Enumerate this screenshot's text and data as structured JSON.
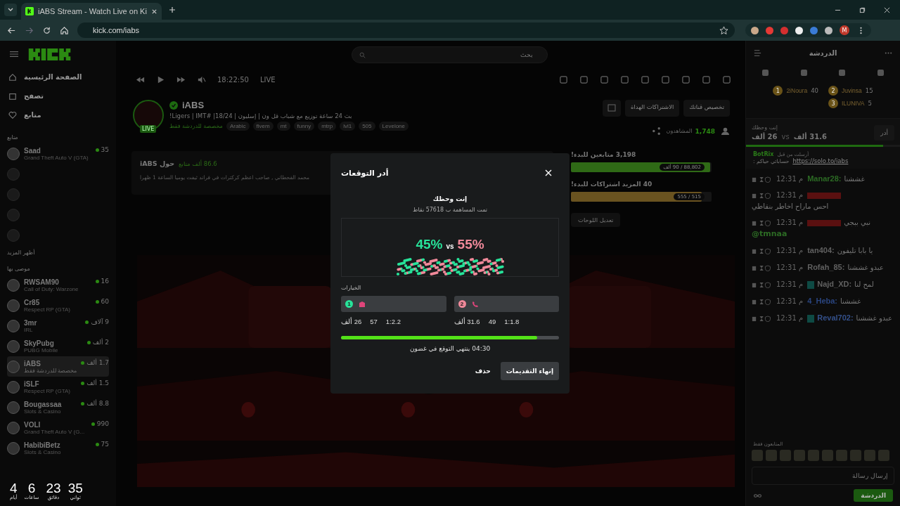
{
  "browser": {
    "tab_title": "iABS Stream - Watch Live on Ki",
    "url": "kick.com/iabs",
    "profile_letter": "M"
  },
  "search": {
    "placeholder": "بحث"
  },
  "sidebar": {
    "nav": [
      {
        "label": "الصفحة الرئيسية"
      },
      {
        "label": "تصفح"
      },
      {
        "label": "متابع"
      }
    ],
    "following_heading": "متابع",
    "following": [
      {
        "name": "Saad",
        "category": "Grand Theft Auto V (GTA)",
        "viewers": "35",
        "live": true
      },
      {
        "live": false
      },
      {
        "live": false
      },
      {
        "live": false
      },
      {
        "live": false
      }
    ],
    "show_more": "أظهر المزيد",
    "recommended_heading": "موصى بها",
    "recommended": [
      {
        "name": "RWSAM90",
        "category": "Call of Duty: Warzone",
        "viewers": "16",
        "selected": false
      },
      {
        "name": "Cr85",
        "category": "Respect RP (GTA)",
        "viewers": "60",
        "selected": false
      },
      {
        "name": "3mr",
        "category": "IRL",
        "viewers": "9 آلاف",
        "selected": false
      },
      {
        "name": "SkyPubg",
        "category": "PUBG Mobile",
        "viewers": "2 ألف",
        "selected": false
      },
      {
        "name": "iABS",
        "category": "مخصصة للدردشة فقط",
        "viewers": "1.7 ألف",
        "selected": true
      },
      {
        "name": "iSLF",
        "category": "Respect RP (GTA)",
        "viewers": "1.5 ألف",
        "selected": false
      },
      {
        "name": "Bougassaa",
        "category": "Slots & Casino",
        "viewers": "8.8 ألف",
        "selected": false
      },
      {
        "name": "VOLI",
        "category": "Grand Theft Auto V (G...",
        "viewers": "990",
        "selected": false
      },
      {
        "name": "HabibiBetz",
        "category": "Slots & Casino",
        "viewers": "75",
        "selected": false
      }
    ]
  },
  "countdown": [
    {
      "value": "35",
      "unit": "ثواني"
    },
    {
      "value": "23",
      "unit": "دقائق"
    },
    {
      "value": "6",
      "unit": "ساعات"
    },
    {
      "value": "4",
      "unit": "أيام"
    }
  ],
  "player": {
    "time": "18:22:50",
    "live_label": "LIVE"
  },
  "channel": {
    "name": "iABS",
    "title": "بث 24 ساعة توزيع مع شباب قل ون | إسليون | 18/24| #Ligers | IMT!",
    "live_badge": "LIVE",
    "chat_only": "مخصصة للدردشة فقط",
    "tags": [
      "Levelone",
      "505",
      "lvl1",
      "mtrp",
      "funny",
      "mt",
      "fivem",
      "Arabic"
    ],
    "buttons": [
      "تخصيص قناتك",
      "الاشتراكات الهداة"
    ],
    "viewers": "1,748",
    "viewers_label": "المشاهدون"
  },
  "about": {
    "title": "حول iABS",
    "followers": "86.6 ألف متابع",
    "description": "محمد القحطاني , صاحب اعظم كركترات في فراند ثيفت يوميا الساعة 1 ظهرا"
  },
  "goals": [
    {
      "title": "3,198 متابعين للبدء!",
      "reading": "88,802 / 90 ألف",
      "level": 0.99,
      "color": "#2f6a16"
    },
    {
      "title": "40 المزيد اشتراكات للبدء!",
      "reading": "515 / 555",
      "level": 0.93,
      "color": "#6a5320"
    }
  ],
  "edit_panels": "تعديل اللوحات",
  "chat": {
    "title": "الدردشة",
    "leaders": [
      {
        "rank": "2",
        "name": "Juvinsa",
        "score": "15"
      },
      {
        "rank": "3",
        "name": "ILUNIVA",
        "score": "5"
      },
      {
        "rank": "1",
        "name": "2iNoura",
        "score": "40"
      }
    ],
    "prediction": {
      "title": "إنت وحظك",
      "left": "31.6 ألف",
      "vs": "vs",
      "right": "26 ألف",
      "button": "أدر",
      "level": 0.89
    },
    "pinned": {
      "user": "BotRix",
      "sent_by": "أرسلت من قبل",
      "text": "حساباتي حياكم :",
      "link": "https://solo.to/iabs"
    },
    "messages": [
      {
        "name": "Manar28:",
        "color": "#2c6a24",
        "time": "12:31 م",
        "text": "غششنا"
      },
      {
        "color": "#5a1010",
        "time": "12:31 م",
        "text": "احس ماراح اخاطر بنقاطي"
      },
      {
        "color": "#5a1010",
        "time": "12:31 م",
        "text": "نبي ببجي",
        "mention": "@tmnaa"
      },
      {
        "name": "tan404:",
        "color": "#606060",
        "time": "12:31 م",
        "text": "يا بابا تليفون"
      },
      {
        "name": "Rofah_85:",
        "color": "#606060",
        "time": "12:31 م",
        "text": "عبدو غششنا"
      },
      {
        "name": "Najd_XD:",
        "color": "#606060",
        "time": "12:31 م",
        "text": "لمح لنا",
        "badges": true
      },
      {
        "name": "4_Heba:",
        "color": "#2a4580",
        "time": "12:31 م",
        "text": "غششنا"
      },
      {
        "name": "Reval702:",
        "color": "#34508a",
        "time": "12:31 م",
        "text": "عبدو غششنا",
        "badges": true
      }
    ],
    "followers_only": "المتابعون فقط",
    "placeholder": "إرسال رسالة",
    "send": "الدردشة"
  },
  "modal": {
    "title": "أدر التوقعات",
    "question": "إنت وحظك",
    "contributed": "تمت المساهمة ب 57618 نقاط",
    "percent_a": "45%",
    "vs": "vs",
    "percent_b": "55%",
    "options_heading": "الخيارات",
    "options": [
      {
        "number": "2",
        "color": "#f0899a",
        "points": "31.6 ألف",
        "users": "49",
        "ratio": "1:1.8"
      },
      {
        "number": "1",
        "color": "#27e39a",
        "points": "26 ألف",
        "users": "57",
        "ratio": "1:2.2"
      }
    ],
    "level": 0.9,
    "timer": "04:30 ينتهي التوقع في غضون",
    "buttons": [
      "إنهاء التقديمات",
      "حذف"
    ]
  }
}
